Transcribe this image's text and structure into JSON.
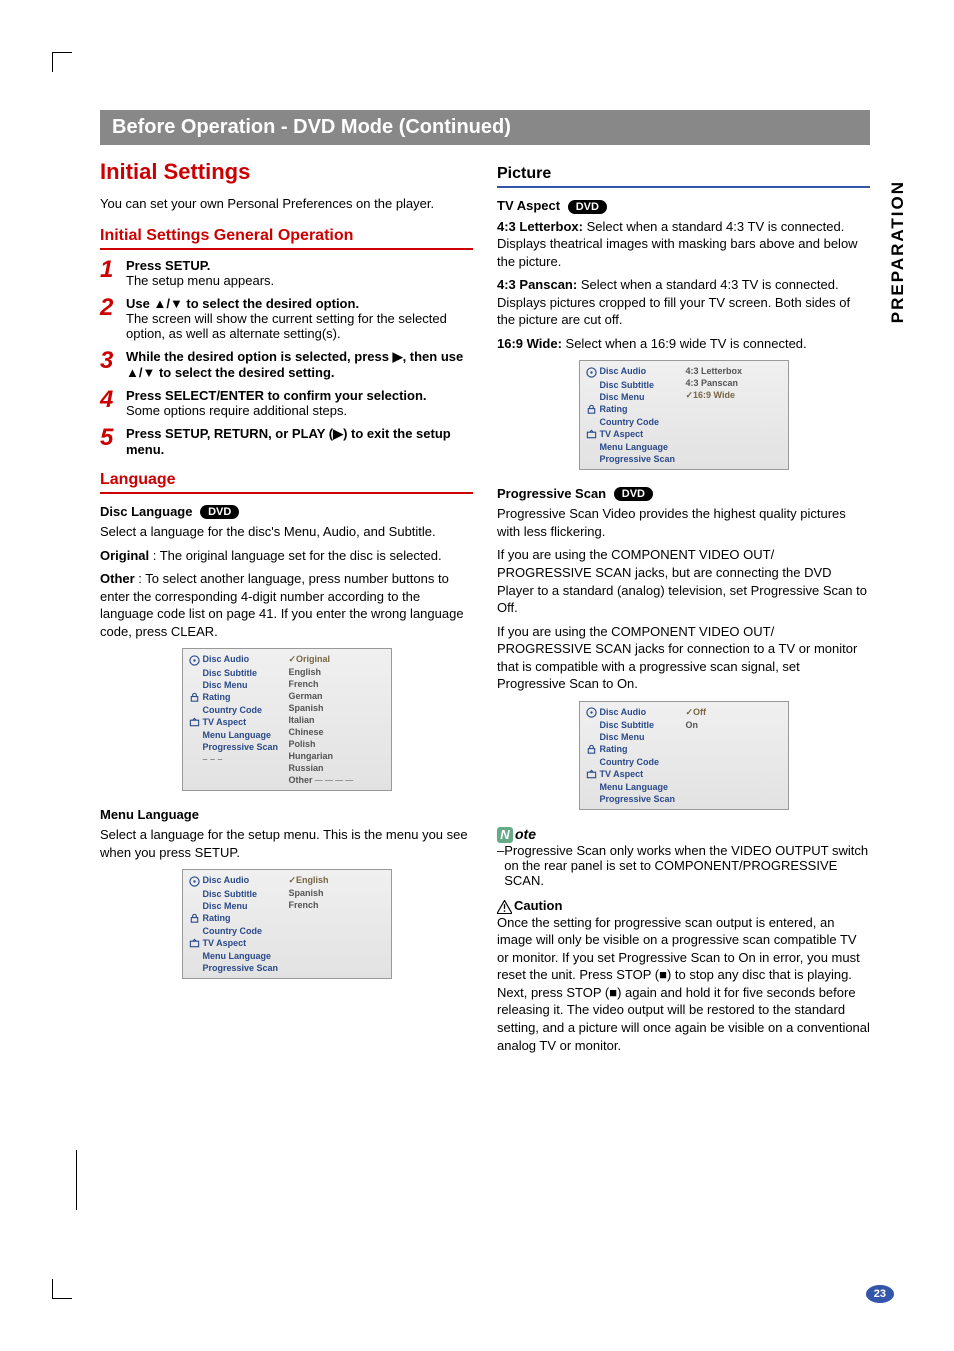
{
  "sideTab": "PREPARATION",
  "pageNumber": "23",
  "banner": "Before Operation - DVD Mode (Continued)",
  "dvdBadge": "DVD",
  "left": {
    "title": "Initial Settings",
    "intro": "You can set your own Personal Preferences on the player.",
    "genOpTitle": "Initial Settings General Operation",
    "steps": {
      "s1_h": "Press SETUP.",
      "s1_b": "The setup menu appears.",
      "s2_h": "Use ▲/▼ to select the desired option.",
      "s2_b": "The screen will show the current setting for the selected option, as well as alternate setting(s).",
      "s3_h": "While the desired option is selected, press ▶, then use ▲/▼ to select the desired setting.",
      "s4_h": "Press SELECT/ENTER to confirm your selection.",
      "s4_b": "Some options require additional steps.",
      "s5_h": "Press SETUP, RETURN, or PLAY (▶) to exit the setup menu."
    },
    "langTitle": "Language",
    "discLangTitle": "Disc Language",
    "discLangIntro": "Select a language for the disc's Menu, Audio, and Subtitle.",
    "discLangOriginal": "Original : The original language set for the disc is selected.",
    "discLangOther": "Other : To select another language, press number buttons to enter the corresponding 4-digit number according to the language code list on page 41. If you enter the wrong language code, press CLEAR.",
    "menuLangTitle": "Menu Language",
    "menuLangBody": "Select a language for the setup menu. This is the menu you see when you press SETUP."
  },
  "right": {
    "pictureTitle": "Picture",
    "tvAspectTitle": "TV Aspect",
    "aspect43L_h": "4:3 Letterbox:",
    "aspect43L_b": " Select when a standard 4:3 TV is connected. Displays theatrical images with masking bars above and below the picture.",
    "aspect43P_h": "4:3 Panscan:",
    "aspect43P_b": " Select when a standard 4:3 TV is connected. Displays pictures cropped to fill your TV screen. Both sides of the picture are cut off.",
    "aspect169_h": "16:9 Wide:",
    "aspect169_b": " Select when a 16:9 wide TV is connected.",
    "progTitle": "Progressive Scan",
    "progBody1": "Progressive Scan Video provides the highest quality pictures with less flickering.",
    "progBody2": "If you are using the COMPONENT VIDEO OUT/ PROGRESSIVE SCAN jacks, but are connecting the DVD Player to a standard (analog) television, set Progressive Scan to Off.",
    "progBody3": "If you are using the COMPONENT VIDEO OUT/ PROGRESSIVE SCAN jacks for connection to a TV or monitor that is compatible with a progressive scan signal, set Progressive Scan to On.",
    "noteTitle": "ote",
    "noteBody": "Progressive Scan only works when the VIDEO OUTPUT switch on the rear panel is set to COMPONENT/PROGRESSIVE SCAN.",
    "cautionTitle": "Caution",
    "cautionBody": "Once the setting for progressive scan output is entered, an image will only be visible on a progressive scan compatible TV or monitor. If you set Progressive Scan to On in error, you must reset the unit. Press STOP (■) to stop any disc that is playing. Next, press STOP (■) again and hold it for five seconds before releasing it. The video output will be restored to the standard setting, and a picture will once again be visible on a conventional analog TV or monitor."
  },
  "osd": {
    "leftItems": [
      "Disc Audio",
      "Disc Subtitle",
      "Disc Menu",
      "Rating",
      "Country Code",
      "TV Aspect",
      "Menu Language",
      "Progressive Scan"
    ],
    "osd1_right": [
      "✓Original",
      "English",
      "French",
      "German",
      "Spanish",
      "Italian",
      "Chinese",
      "Polish",
      "Hungarian",
      "Russian",
      "Other"
    ],
    "osd2_right": [
      "✓English",
      "Spanish",
      "French"
    ],
    "osd3_right": [
      "4:3 Letterbox",
      "4:3 Panscan",
      "✓16:9 Wide"
    ],
    "osd4_right": [
      "✓Off",
      "On"
    ]
  }
}
